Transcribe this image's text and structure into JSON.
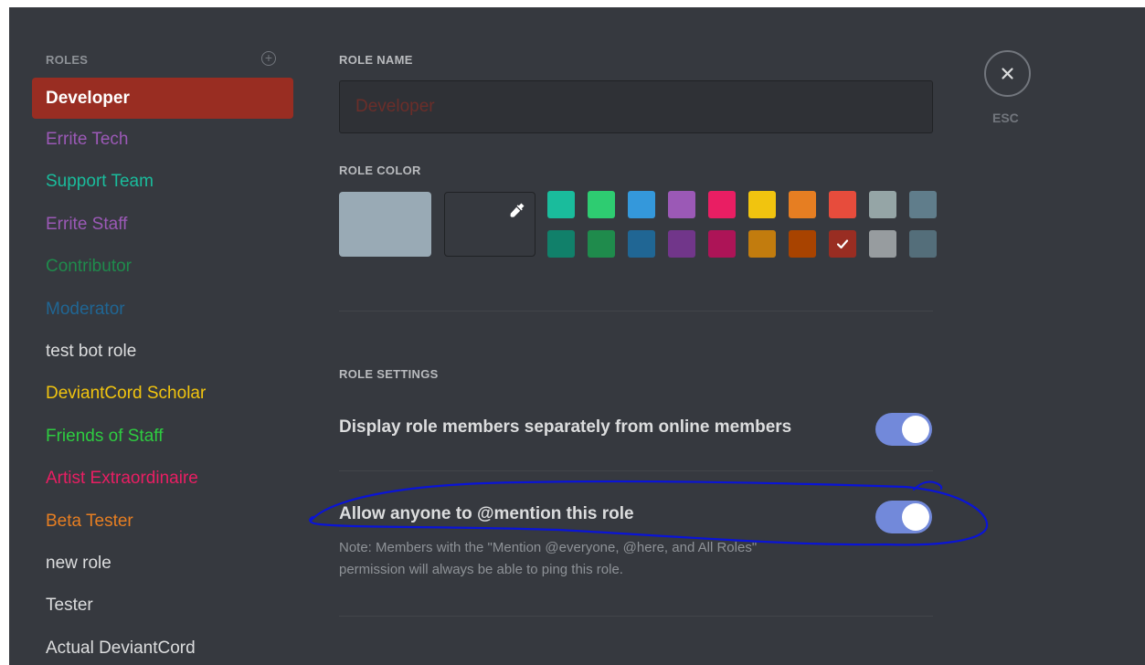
{
  "sidebar": {
    "header": "ROLES",
    "roles": [
      {
        "label": "Developer",
        "color": "#ffffff",
        "selected": true
      },
      {
        "label": "Errite Tech",
        "color": "#9b59b6"
      },
      {
        "label": "Support Team",
        "color": "#1abc9c"
      },
      {
        "label": "Errite Staff",
        "color": "#9b59b6"
      },
      {
        "label": "Contributor",
        "color": "#1f8b4c"
      },
      {
        "label": "Moderator",
        "color": "#206694"
      },
      {
        "label": "test bot role",
        "color": "#dcddde"
      },
      {
        "label": "DeviantCord Scholar",
        "color": "#f1c40f"
      },
      {
        "label": "Friends of Staff",
        "color": "#2ecc40"
      },
      {
        "label": "Artist Extraordinaire",
        "color": "#e91e63"
      },
      {
        "label": "Beta Tester",
        "color": "#e67e22"
      },
      {
        "label": "new role",
        "color": "#dcddde"
      },
      {
        "label": "Tester",
        "color": "#dcddde"
      },
      {
        "label": "Actual DeviantCord",
        "color": "#dcddde"
      }
    ]
  },
  "role_name": {
    "label": "ROLE NAME",
    "placeholder": "Developer",
    "color": "#992d22"
  },
  "role_color": {
    "label": "ROLE COLOR",
    "current": "#99aab5",
    "swatches": [
      [
        "#1abc9c",
        "#2ecc71",
        "#3498db",
        "#9b59b6",
        "#e91e63",
        "#f1c40f",
        "#e67e22",
        "#e74c3c",
        "#95a5a6",
        "#607d8b"
      ],
      [
        "#11806a",
        "#1f8b4c",
        "#206694",
        "#71368a",
        "#ad1457",
        "#c27c0e",
        "#a84300",
        "#992d22",
        "#979c9f",
        "#546e7a"
      ]
    ],
    "selected_swatch": "#992d22"
  },
  "settings": {
    "label": "ROLE SETTINGS",
    "display_separately": {
      "text": "Display role members separately from online members",
      "enabled": true
    },
    "mentionable": {
      "text_before": "Allow anyone to ",
      "text_bold": "@mention",
      "text_after": " this role",
      "enabled": true,
      "note_line1": "Note: Members with the \"Mention @everyone, @here, and All Roles\"",
      "note_line2": "permission will always be able to ping this role."
    }
  },
  "close": {
    "label": "ESC"
  },
  "colors": {
    "toggle_on": "#7289da",
    "background": "#36393f",
    "annotation": "#0000cc"
  }
}
